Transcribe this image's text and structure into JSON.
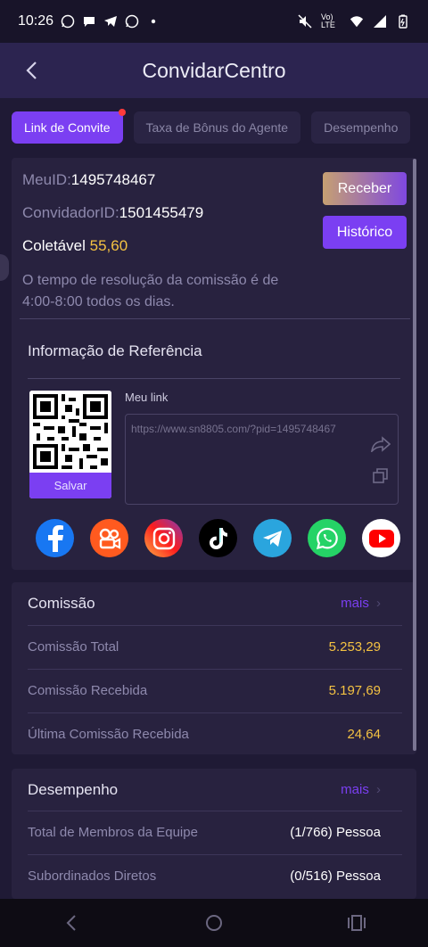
{
  "status_bar": {
    "time": "10:26",
    "network": "Vo) LTE"
  },
  "header": {
    "title": "ConvidarCentro"
  },
  "tabs": [
    {
      "label": "Link de Convite"
    },
    {
      "label": "Taxa de Bônus do Agente"
    },
    {
      "label": "Desempenho"
    }
  ],
  "account": {
    "my_id_label": "MeuID:",
    "my_id_value": "1495748467",
    "inviter_label": "ConvidadorID:",
    "inviter_value": "1501455479",
    "collectable_label": "Coletável",
    "collectable_value": "55,60",
    "note": "O tempo de resolução da comissão é de 4:00-8:00 todos os dias.",
    "receive_label": "Receber",
    "history_label": "Histórico"
  },
  "referral": {
    "title": "Informação de Referência",
    "save_label": "Salvar",
    "link_label": "Meu link",
    "link_url": "https://www.sn8805.com/?pid=1495748467",
    "socials": [
      "facebook-icon",
      "kwai-icon",
      "instagram-icon",
      "tiktok-icon",
      "telegram-icon",
      "whatsapp-icon",
      "youtube-icon"
    ]
  },
  "commission": {
    "title": "Comissão",
    "more_label": "mais",
    "rows": [
      {
        "label": "Comissão Total",
        "value": "5.253,29"
      },
      {
        "label": "Comissão Recebida",
        "value": "5.197,69"
      },
      {
        "label": "Última Comissão Recebida",
        "value": "24,64"
      }
    ]
  },
  "performance": {
    "title": "Desempenho",
    "more_label": "mais",
    "rows": [
      {
        "label": "Total de Membros da Equipe",
        "value": "(1/766) Pessoa"
      },
      {
        "label": "Subordinados Diretos",
        "value": "(0/516) Pessoa"
      }
    ]
  },
  "colors": {
    "accent": "#7b3ff2",
    "gold": "#f4c242",
    "background": "#1f1a35",
    "card": "#28223f"
  }
}
